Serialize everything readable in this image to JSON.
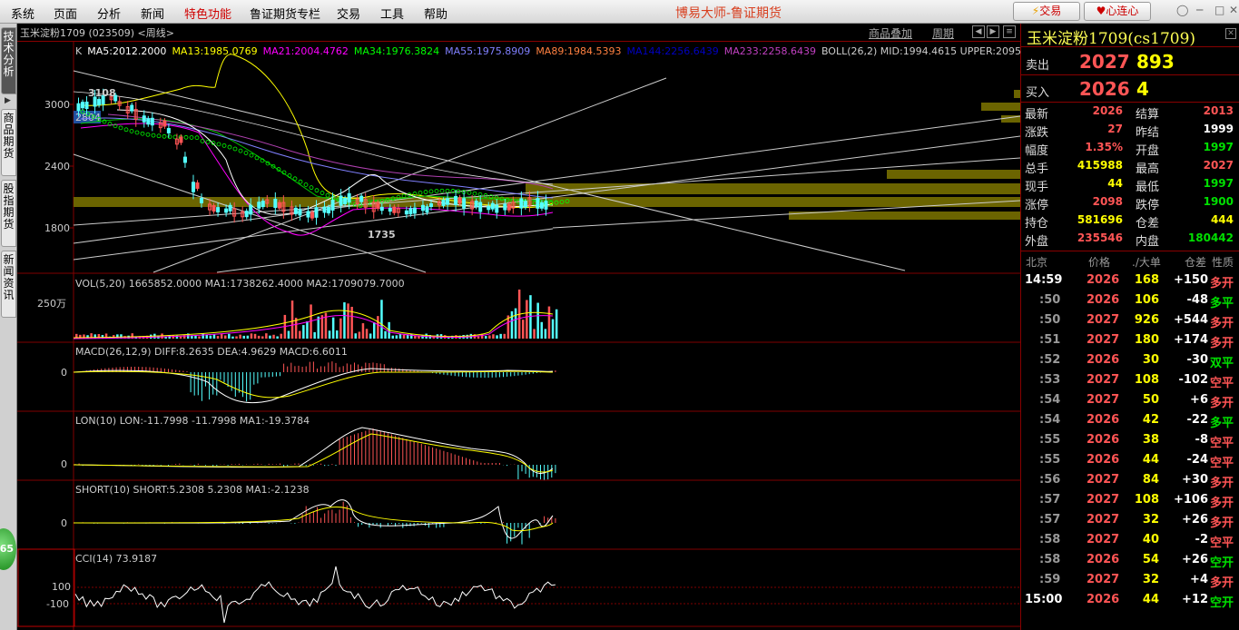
{
  "menu": {
    "items": [
      {
        "label": "系统",
        "key": "system"
      },
      {
        "label": "页面",
        "key": "page"
      },
      {
        "label": "分析",
        "key": "analysis"
      },
      {
        "label": "新闻",
        "key": "news"
      },
      {
        "label": "特色功能",
        "key": "features",
        "highlight": true
      },
      {
        "label": "鲁证期货专栏",
        "key": "column"
      },
      {
        "label": "交易",
        "key": "trade"
      },
      {
        "label": "工具",
        "key": "tools"
      },
      {
        "label": "帮助",
        "key": "help"
      }
    ],
    "app_title": "博易大师-鲁证期货",
    "trade_button": "交易",
    "xinlianxin_button": "心连心"
  },
  "sidebar": {
    "tabs": [
      {
        "label": "技术分析",
        "key": "tech",
        "active": true
      },
      {
        "label": "商品期货",
        "key": "commodity"
      },
      {
        "label": "股指期货",
        "key": "index"
      },
      {
        "label": "新闻资讯",
        "key": "news"
      }
    ],
    "ball_value": "65"
  },
  "chart_header": {
    "symbol": "玉米淀粉1709 (023509) <周线>",
    "overlay_link": "商品叠加",
    "period_link": "周期"
  },
  "main_panel": {
    "indicator_line": [
      {
        "text": "K",
        "color": "#cccccc"
      },
      {
        "text": "MA5:2012.2000",
        "color": "#ffffff"
      },
      {
        "text": "MA13:1985.0769",
        "color": "#ffff00"
      },
      {
        "text": "MA21:2004.4762",
        "color": "#ff00ff"
      },
      {
        "text": "MA34:1976.3824",
        "color": "#00ff00"
      },
      {
        "text": "MA55:1975.8909",
        "color": "#8080ff"
      },
      {
        "text": "MA89:1984.5393",
        "color": "#ff8040"
      },
      {
        "text": "MA144:2256.6439",
        "color": "#0000c0"
      },
      {
        "text": "MA233:2258.6439",
        "color": "#c040c0"
      },
      {
        "text": "BOLL(26,2) MID:1994.4615 UPPER:2095",
        "color": "#cccccc"
      }
    ],
    "y_ticks": [
      "3000",
      "2400",
      "1800"
    ],
    "high_label": "3108",
    "low_label": "1735",
    "price_tag": "2804"
  },
  "vol_panel": {
    "title": "VOL(5,20) 1665852.0000 MA1:1738262.4000 MA2:1709079.7000",
    "y_tick": "250万"
  },
  "macd_panel": {
    "title": "MACD(26,12,9) DIFF:8.2635 DEA:4.9629 MACD:6.6011",
    "y_tick": "0"
  },
  "lon_panel": {
    "title": "LON(10) LON:-11.7998 -11.7998 MA1:-19.3784",
    "y_tick": "0"
  },
  "short_panel": {
    "title": "SHORT(10) SHORT:5.2308 5.2308 MA1:-2.1238",
    "y_tick": "0"
  },
  "cci_panel": {
    "title": "CCI(14) 73.9187",
    "y_ticks": [
      "100",
      "-100"
    ]
  },
  "quote": {
    "title": "玉米淀粉1709(cs1709)",
    "sell": {
      "label": "卖出",
      "price": "2027",
      "vol": "893"
    },
    "buy": {
      "label": "买入",
      "price": "2026",
      "vol": "4"
    },
    "stats": [
      {
        "l1": "最新",
        "v1": "2026",
        "c1": "red",
        "l2": "结算",
        "v2": "2013",
        "c2": "red"
      },
      {
        "l1": "涨跌",
        "v1": "27",
        "c1": "red",
        "l2": "昨结",
        "v2": "1999",
        "c2": "white"
      },
      {
        "l1": "幅度",
        "v1": "1.35%",
        "c1": "red",
        "l2": "开盘",
        "v2": "1997",
        "c2": "green"
      },
      {
        "l1": "总手",
        "v1": "415988",
        "c1": "yel",
        "l2": "最高",
        "v2": "2027",
        "c2": "red"
      },
      {
        "l1": "现手",
        "v1": "44",
        "c1": "yel",
        "l2": "最低",
        "v2": "1997",
        "c2": "green"
      },
      {
        "l1": "涨停",
        "v1": "2098",
        "c1": "red",
        "l2": "跌停",
        "v2": "1900",
        "c2": "green"
      },
      {
        "l1": "持仓",
        "v1": "581696",
        "c1": "yel",
        "l2": "仓差",
        "v2": "444",
        "c2": "yel"
      },
      {
        "l1": "外盘",
        "v1": "235546",
        "c1": "red",
        "l2": "内盘",
        "v2": "180442",
        "c2": "green"
      }
    ],
    "tick_header": {
      "time": "北京",
      "price": "价格",
      "vol": "./大单",
      "diff": "仓差",
      "nature": "性质"
    },
    "ticks": [
      {
        "time": "14:59",
        "price": "2026",
        "vol": "168",
        "diff": "+150",
        "nature": "多开",
        "pc": "red",
        "nc": "red",
        "tc": "white"
      },
      {
        "time": ":50",
        "price": "2026",
        "vol": "106",
        "diff": "-48",
        "nature": "多平",
        "pc": "red",
        "nc": "green",
        "tc": "gray"
      },
      {
        "time": ":50",
        "price": "2027",
        "vol": "926",
        "diff": "+544",
        "nature": "多开",
        "pc": "red",
        "nc": "red",
        "tc": "gray"
      },
      {
        "time": ":51",
        "price": "2027",
        "vol": "180",
        "diff": "+174",
        "nature": "多开",
        "pc": "red",
        "nc": "red",
        "tc": "gray"
      },
      {
        "time": ":52",
        "price": "2026",
        "vol": "30",
        "diff": "-30",
        "nature": "双平",
        "pc": "red",
        "nc": "green",
        "tc": "gray"
      },
      {
        "time": ":53",
        "price": "2027",
        "vol": "108",
        "diff": "-102",
        "nature": "空平",
        "pc": "red",
        "nc": "red",
        "tc": "gray"
      },
      {
        "time": ":54",
        "price": "2027",
        "vol": "50",
        "diff": "+6",
        "nature": "多开",
        "pc": "red",
        "nc": "red",
        "tc": "gray"
      },
      {
        "time": ":54",
        "price": "2026",
        "vol": "42",
        "diff": "-22",
        "nature": "多平",
        "pc": "red",
        "nc": "green",
        "tc": "gray"
      },
      {
        "time": ":55",
        "price": "2026",
        "vol": "38",
        "diff": "-8",
        "nature": "空平",
        "pc": "red",
        "nc": "red",
        "tc": "gray"
      },
      {
        "time": ":55",
        "price": "2026",
        "vol": "44",
        "diff": "-24",
        "nature": "空平",
        "pc": "red",
        "nc": "red",
        "tc": "gray"
      },
      {
        "time": ":56",
        "price": "2027",
        "vol": "84",
        "diff": "+30",
        "nature": "多开",
        "pc": "red",
        "nc": "red",
        "tc": "gray"
      },
      {
        "time": ":57",
        "price": "2027",
        "vol": "108",
        "diff": "+106",
        "nature": "多开",
        "pc": "red",
        "nc": "red",
        "tc": "gray"
      },
      {
        "time": ":57",
        "price": "2027",
        "vol": "32",
        "diff": "+26",
        "nature": "多开",
        "pc": "red",
        "nc": "red",
        "tc": "gray"
      },
      {
        "time": ":58",
        "price": "2027",
        "vol": "40",
        "diff": "-2",
        "nature": "空平",
        "pc": "red",
        "nc": "red",
        "tc": "gray"
      },
      {
        "time": ":58",
        "price": "2026",
        "vol": "54",
        "diff": "+26",
        "nature": "空开",
        "pc": "red",
        "nc": "green",
        "tc": "gray"
      },
      {
        "time": ":59",
        "price": "2027",
        "vol": "32",
        "diff": "+4",
        "nature": "多开",
        "pc": "red",
        "nc": "red",
        "tc": "gray"
      },
      {
        "time": "15:00",
        "price": "2026",
        "vol": "44",
        "diff": "+12",
        "nature": "空开",
        "pc": "red",
        "nc": "green",
        "tc": "white"
      }
    ]
  },
  "colors": {
    "up": "#ff5555",
    "down": "#54ffff",
    "grid": "#800000"
  }
}
